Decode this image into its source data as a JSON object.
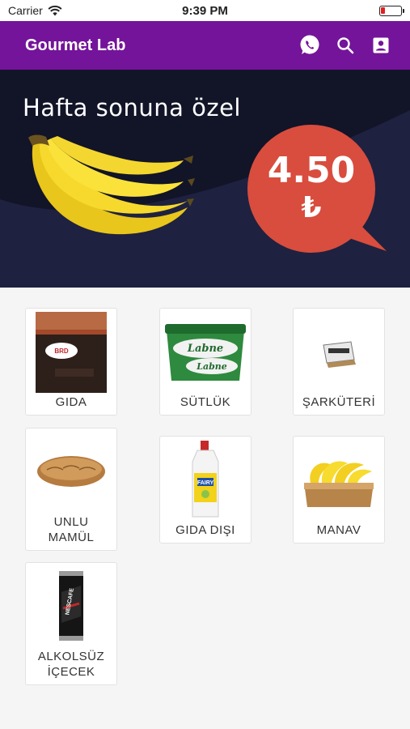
{
  "status_bar": {
    "carrier": "Carrier",
    "time": "9:39 PM"
  },
  "app_bar": {
    "title": "Gourmet Lab",
    "icons": [
      "whatsapp-icon",
      "search-icon",
      "contact-card-icon"
    ],
    "color": "#74149a"
  },
  "banner": {
    "title": "Hafta sonuna özel",
    "price": "4.50",
    "currency": "₺",
    "price_color": "#d84d3e",
    "background": "#121428"
  },
  "categories": [
    {
      "label": "GIDA",
      "image": "coffee-package-image"
    },
    {
      "label": "SÜTLÜK",
      "image": "labne-tub-image"
    },
    {
      "label": "ŞARKÜTERİ",
      "image": "deli-pack-image"
    },
    {
      "label": "UNLU\nMAMÜL",
      "image": "bread-image"
    },
    {
      "label": "GIDA DIŞI",
      "image": "detergent-bottle-image"
    },
    {
      "label": "MANAV",
      "image": "banana-crate-image"
    },
    {
      "label": "ALKOLSÜZ\nİÇECEK",
      "image": "coffee-can-image"
    }
  ]
}
